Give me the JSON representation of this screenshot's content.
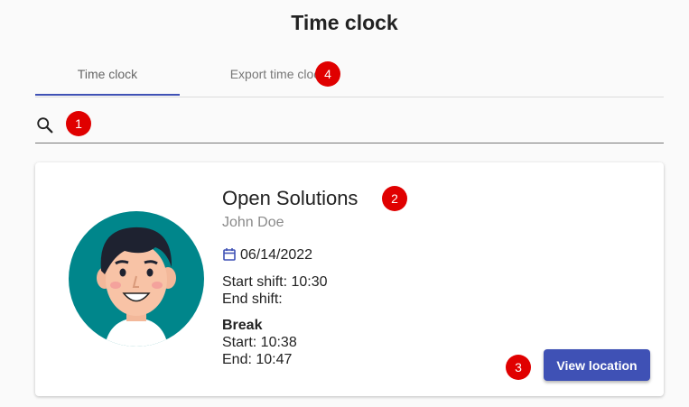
{
  "page": {
    "title": "Time clock"
  },
  "tabs": [
    {
      "label": "Time clock",
      "active": true
    },
    {
      "label": "Export time clock",
      "active": false
    }
  ],
  "search": {
    "value": "",
    "placeholder": "",
    "icon": "search-icon"
  },
  "markers": [
    "1",
    "2",
    "3",
    "4"
  ],
  "colors": {
    "accent": "#3f51b5",
    "marker": "#e00000",
    "avatar_bg": "#00868b"
  },
  "card": {
    "company": "Open Solutions",
    "user": "John Doe",
    "date_icon": "calendar-icon",
    "date": "06/14/2022",
    "start_shift": "Start shift: 10:30",
    "end_shift": "End shift:",
    "break_title": "Break",
    "break_start": "Start: 10:38",
    "break_end": "End: 10:47",
    "view_location_label": "View location"
  }
}
